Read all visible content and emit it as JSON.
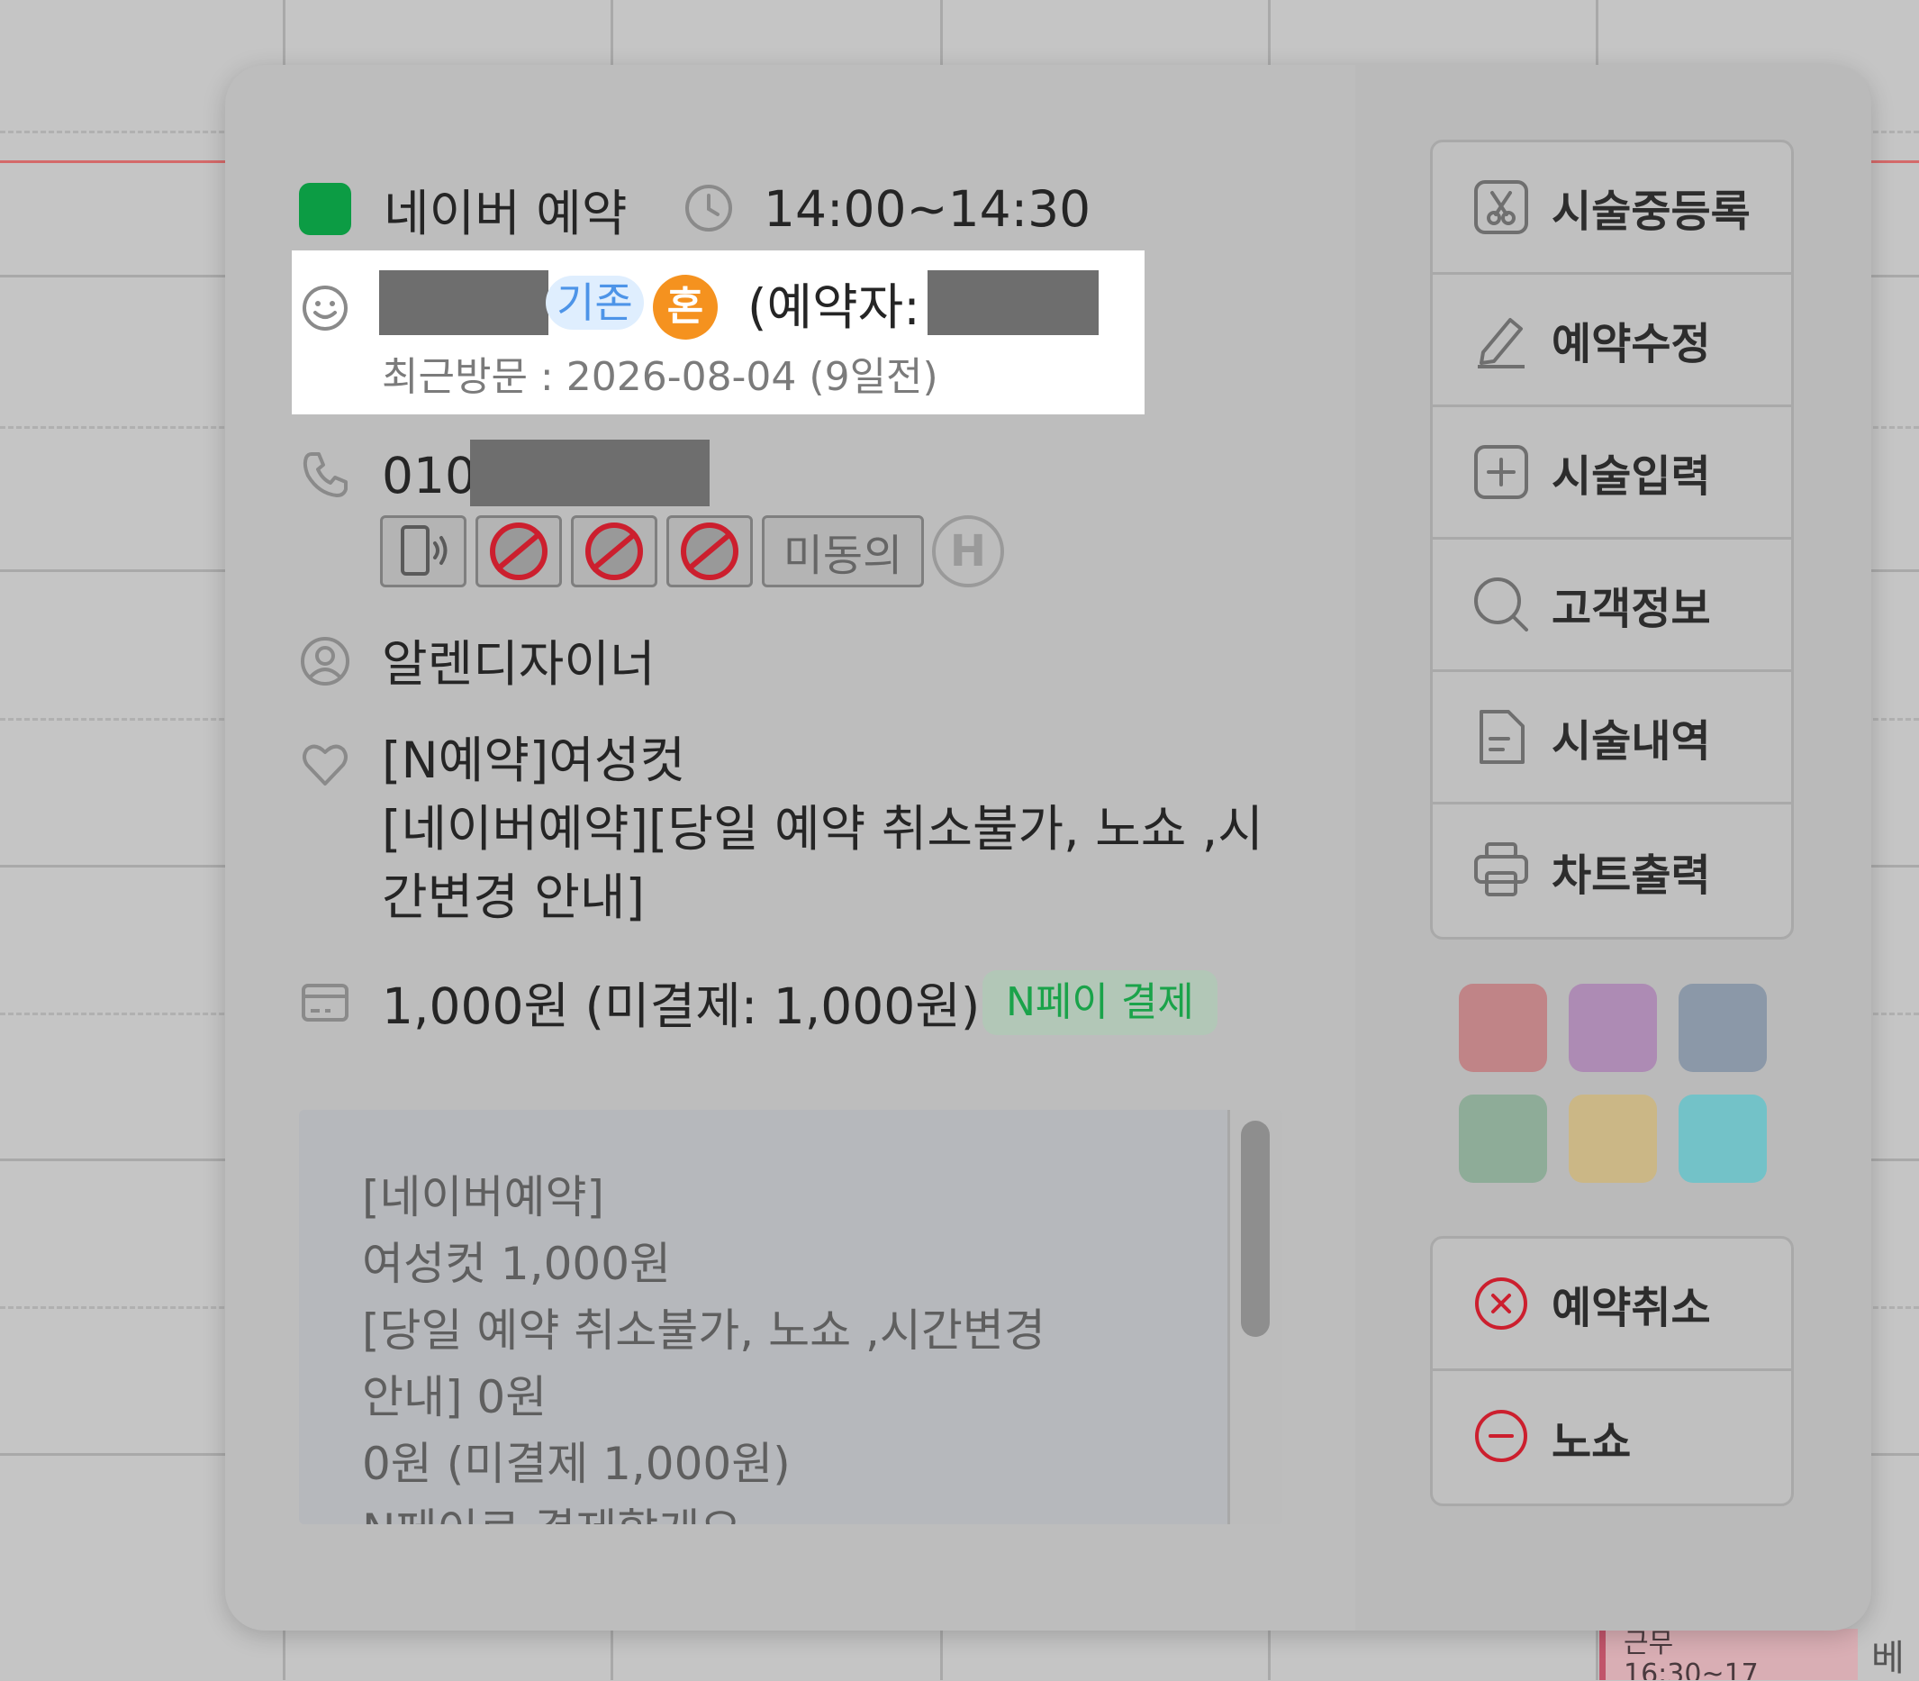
{
  "reservation": {
    "source": "네이버 예약",
    "time": "14:00~14:30",
    "customer_tag": "기존",
    "customer_badge": "혼",
    "booker_label": "(예약자:",
    "last_visit": "최근방문 : 2026-08-04 (9일전)",
    "phone_prefix": "010",
    "consent_label": "미동의",
    "h_badge": "H",
    "designer": "알렌디자이너",
    "service_line1": "[N예약]여성컷",
    "service_line2": "[네이버예약][당일 예약 취소불가, 노쇼 ,시",
    "service_line3": "간변경 안내]",
    "payment": "1,000원 (미결제: 1,000원)",
    "payment_tag": "N페이 결제",
    "memo": "[네이버예약]\n여성컷 1,000원\n[당일 예약 취소불가, 노쇼 ,시간변경\n안내] 0원\n0원 (미결제 1,000원)\nN페이로 결제할게요"
  },
  "actions": {
    "register_in_progress": "시술중등록",
    "edit_reservation": "예약수정",
    "enter_service": "시술입력",
    "customer_info": "고객정보",
    "service_history": "시술내역",
    "print_chart": "차트출력",
    "cancel_reservation": "예약취소",
    "no_show": "노쇼"
  },
  "colors": {
    "source_green": "#0c9c44",
    "tag_blue": "#4d94e8",
    "badge_orange": "#f5921f",
    "npay_green": "#1aa34a",
    "danger_red": "#cc1f2e",
    "swatches": [
      "#c08487",
      "#ad8bb4",
      "#8b98a8",
      "#8eac98",
      "#cbb786",
      "#73c2c8"
    ]
  },
  "calendar": {
    "event_line1": "근무",
    "event_line2": "16:30~17",
    "edge_text": "베"
  }
}
